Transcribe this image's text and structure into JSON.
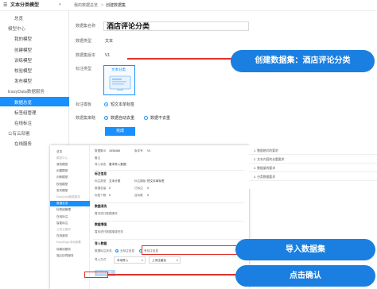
{
  "sidebar": {
    "app_title": "文本分类模型",
    "items": [
      {
        "label": "总览",
        "kind": "item"
      },
      {
        "label": "模型中心",
        "kind": "group"
      },
      {
        "label": "我的模型",
        "kind": "item"
      },
      {
        "label": "创建模型",
        "kind": "item"
      },
      {
        "label": "训练模型",
        "kind": "item"
      },
      {
        "label": "校验模型",
        "kind": "item"
      },
      {
        "label": "发布模型",
        "kind": "item"
      },
      {
        "label": "EasyData数据服务",
        "kind": "group"
      },
      {
        "label": "数据总览",
        "kind": "active"
      },
      {
        "label": "标签组管理",
        "kind": "item"
      },
      {
        "label": "在线标注",
        "kind": "item"
      },
      {
        "label": "公有云部署",
        "kind": "group"
      },
      {
        "label": "在线服务",
        "kind": "item"
      }
    ]
  },
  "breadcrumb": {
    "parent": "我的数据总览",
    "sep": ">",
    "current": "创建数据集"
  },
  "form": {
    "name_label": "数据集名称",
    "name_value": "酒店评论分类",
    "type_label": "数据类型",
    "type_value": "文本",
    "version_label": "数据集版本",
    "version_value": "V1",
    "annotation_type_label": "标注类型",
    "annotation_card_label": "文本分类",
    "template_label": "标注模板",
    "template_option": "短文本单标签",
    "dedupe_label": "数据集策略",
    "dedupe_on": "数据自动去重",
    "dedupe_off": "数据不去重",
    "submit_label": "完成"
  },
  "callouts": {
    "create": "创建数据集：酒店评论分类",
    "import": "导入数据集",
    "confirm": "点击确认"
  },
  "overlay": {
    "sidebar_items": [
      {
        "label": "总览",
        "kind": "item"
      },
      {
        "label": "模型中心",
        "kind": "muted"
      },
      {
        "label": "我的模型",
        "kind": "item"
      },
      {
        "label": "创建模型",
        "kind": "item"
      },
      {
        "label": "训练模型",
        "kind": "item"
      },
      {
        "label": "校验模型",
        "kind": "item"
      },
      {
        "label": "发布模型",
        "kind": "item"
      },
      {
        "label": "EasyData数据服务",
        "kind": "muted"
      },
      {
        "label": "数据总览",
        "kind": "active"
      },
      {
        "label": "标签组管理",
        "kind": "item"
      },
      {
        "label": "在线标注",
        "kind": "item"
      },
      {
        "label": "智能标注",
        "kind": "item"
      },
      {
        "label": "公有云服务",
        "kind": "muted"
      },
      {
        "label": "在线服务",
        "kind": "item"
      },
      {
        "label": "EasyEdge本地部署",
        "kind": "muted"
      },
      {
        "label": "纯离线服务",
        "kind": "item"
      },
      {
        "label": "端云协同服务",
        "kind": "item"
      }
    ],
    "id_label": "数据集ID",
    "id_value": "1636466",
    "ver_label": "版本号",
    "ver_value": "V1",
    "note_label": "备注",
    "status_label": "导入状态",
    "status_value": "暂未导入数据",
    "section_annotation": "标注信息",
    "ann_type_label": "标注类型",
    "ann_type_value": "文本分类",
    "ann_tpl_label": "标注模板",
    "ann_tpl_value": "短文本单标签",
    "total_label": "数据总量",
    "total_value": "0",
    "labeled_label": "已标注",
    "labeled_value": "0",
    "tags_label": "标签个数",
    "tags_value": "0",
    "pending_label": "目标数",
    "pending_value": "0",
    "section_clean": "数据清洗",
    "clean_note": "暂未进行数据清洗",
    "section_enhance": "数据增强",
    "enhance_note": "暂未进行数据增强任务",
    "section_import": "导入数据",
    "mode_label": "数据标注状态",
    "mode_unlabeled": "无标注信息",
    "mode_labeled": "有标注信息",
    "method_label": "导入方式",
    "method_value": "本地导入",
    "upload_value": "上传压缩包",
    "confirm_button": "确认并返回"
  },
  "right_list": [
    "1. 数据格式的要求",
    "2. 文本内容的去重要求",
    "3. 数据量的要求",
    "4. 分类数据要求"
  ],
  "colors": {
    "accent": "#1890ff",
    "banner": "#1a7fe0",
    "highlight": "#e0302a"
  }
}
